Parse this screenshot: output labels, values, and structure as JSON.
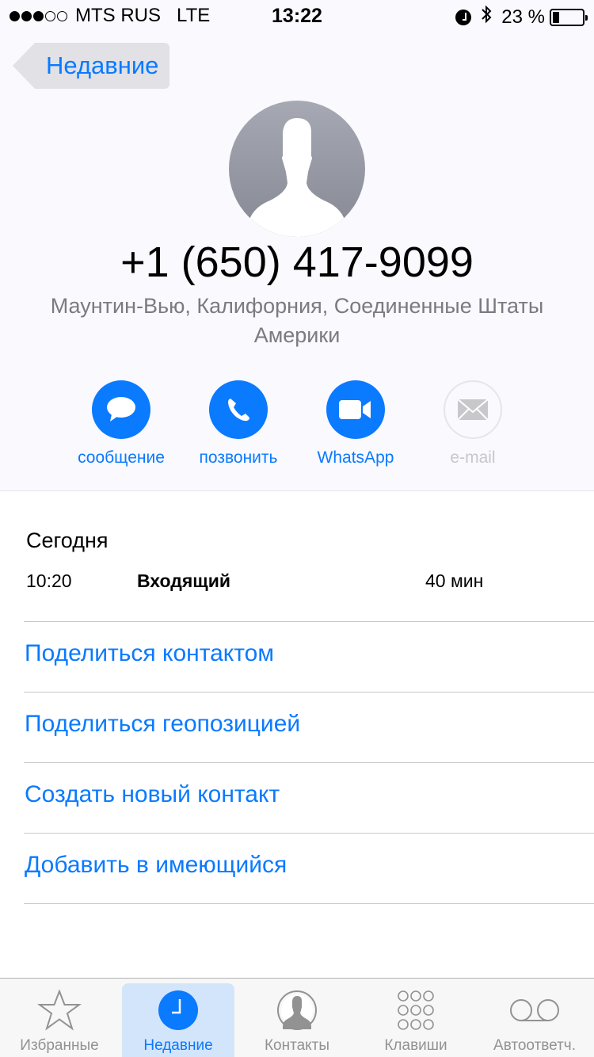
{
  "status_bar": {
    "signal_bars_filled": 3,
    "signal_bars_total": 5,
    "carrier": "MTS RUS",
    "network": "LTE",
    "time": "13:22",
    "alarm_icon": "alarm-clock-icon",
    "bluetooth_icon": "bluetooth-icon",
    "battery_percent_label": "23 %",
    "battery_level": 0.23
  },
  "nav": {
    "back_label": "Недавние"
  },
  "contact": {
    "avatar_icon": "person-silhouette-icon",
    "phone_number": "+1 (650) 417-9099",
    "location": "Маунтин-Вью, Калифорния, Соединенные Штаты Америки"
  },
  "actions": [
    {
      "label": "сообщение",
      "icon": "message-bubble-icon",
      "enabled": true
    },
    {
      "label": "позвонить",
      "icon": "phone-icon",
      "enabled": true
    },
    {
      "label": "WhatsApp",
      "icon": "video-camera-icon",
      "enabled": true
    },
    {
      "label": "e-mail",
      "icon": "envelope-icon",
      "enabled": false
    }
  ],
  "history": {
    "date_header": "Сегодня",
    "calls": [
      {
        "time": "10:20",
        "type": "Входящий",
        "duration": "40 мин"
      }
    ]
  },
  "links": [
    {
      "label": "Поделиться контактом"
    },
    {
      "label": "Поделиться геопозицией"
    },
    {
      "label": "Создать новый контакт"
    },
    {
      "label": "Добавить в имеющийся"
    }
  ],
  "colors": {
    "accent": "#0a7aff",
    "secondary_text": "#7b7b7f",
    "active_tab_bg": "#d3e5fa"
  },
  "tab_bar": {
    "active_index": 1,
    "tabs": [
      {
        "label": "Избранные",
        "icon": "star-icon"
      },
      {
        "label": "Недавние",
        "icon": "clock-icon"
      },
      {
        "label": "Контакты",
        "icon": "contact-icon"
      },
      {
        "label": "Клавиши",
        "icon": "keypad-icon"
      },
      {
        "label": "Автоответч.",
        "icon": "voicemail-icon"
      }
    ]
  }
}
